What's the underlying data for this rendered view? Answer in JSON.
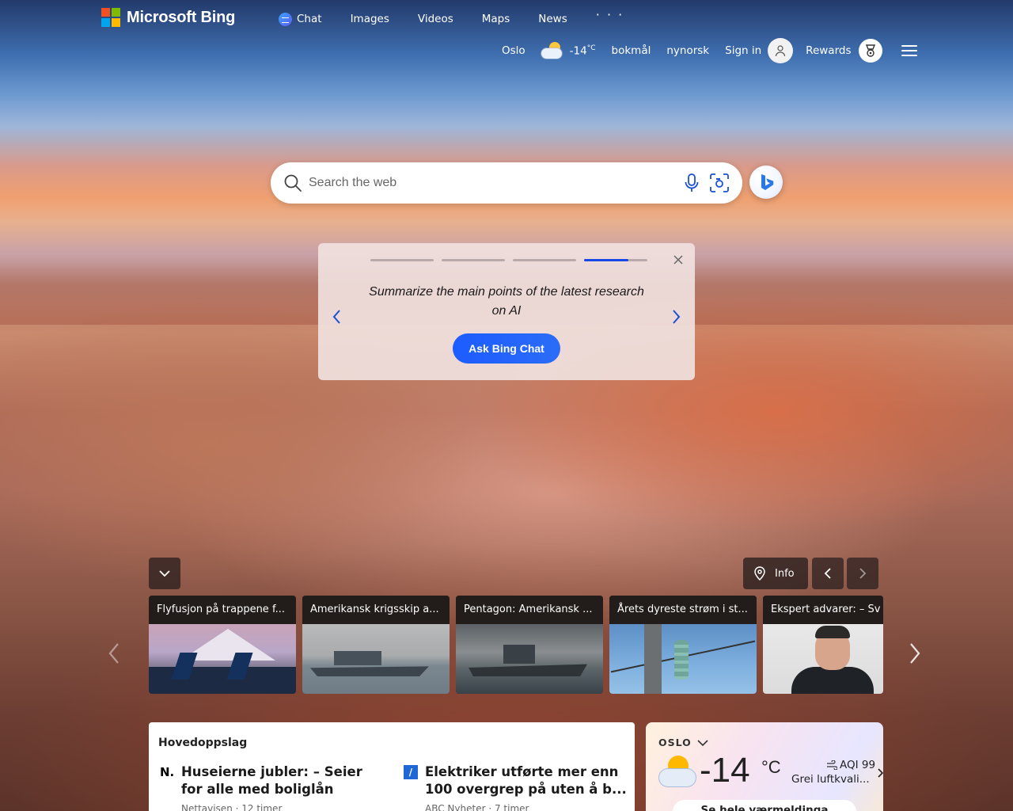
{
  "header": {
    "logo_text": "Microsoft Bing",
    "nav": [
      {
        "label": "Chat"
      },
      {
        "label": "Images"
      },
      {
        "label": "Videos"
      },
      {
        "label": "Maps"
      },
      {
        "label": "News"
      }
    ],
    "more_label": "· · ·",
    "weather_city": "Oslo",
    "weather_temp": "-14",
    "weather_unit": "°C",
    "lang1": "bokmål",
    "lang2": "nynorsk",
    "signin_label": "Sign in",
    "rewards_label": "Rewards"
  },
  "search": {
    "placeholder": "Search the web"
  },
  "promo": {
    "text": "Summarize the main points of the latest research on AI",
    "button_label": "Ask Bing Chat",
    "progress_count": 4,
    "active_step": 4
  },
  "controls": {
    "info_label": "Info"
  },
  "carousel": [
    {
      "title": "Flyfusjon på trappene f..."
    },
    {
      "title": "Amerikansk krigsskip a..."
    },
    {
      "title": "Pentagon: Amerikansk ..."
    },
    {
      "title": "Årets dyreste strøm i st..."
    },
    {
      "title": "Ekspert advarer: – Sv"
    }
  ],
  "headlines": {
    "title": "Hovedoppslag",
    "stories": [
      {
        "source_icon": "N.",
        "headline": "Huseierne jubler: – Seier for alle med boliglån",
        "meta": "Nettavisen · 12 timer"
      },
      {
        "source_icon": "/",
        "headline": "Elektriker utførte mer enn 100 overgrep på uten å b...",
        "meta": "ABC Nyheter · 7 timer"
      }
    ]
  },
  "weather": {
    "city": "OSLO",
    "temp": "-14",
    "unit": "°C",
    "aqi": "AQI 99",
    "aqi_text": "Grei luftkvali...",
    "button_label": "Se hele værmeldinga"
  },
  "colors": {
    "accent": "#174ae4",
    "button_blue": "#1d5cff"
  }
}
